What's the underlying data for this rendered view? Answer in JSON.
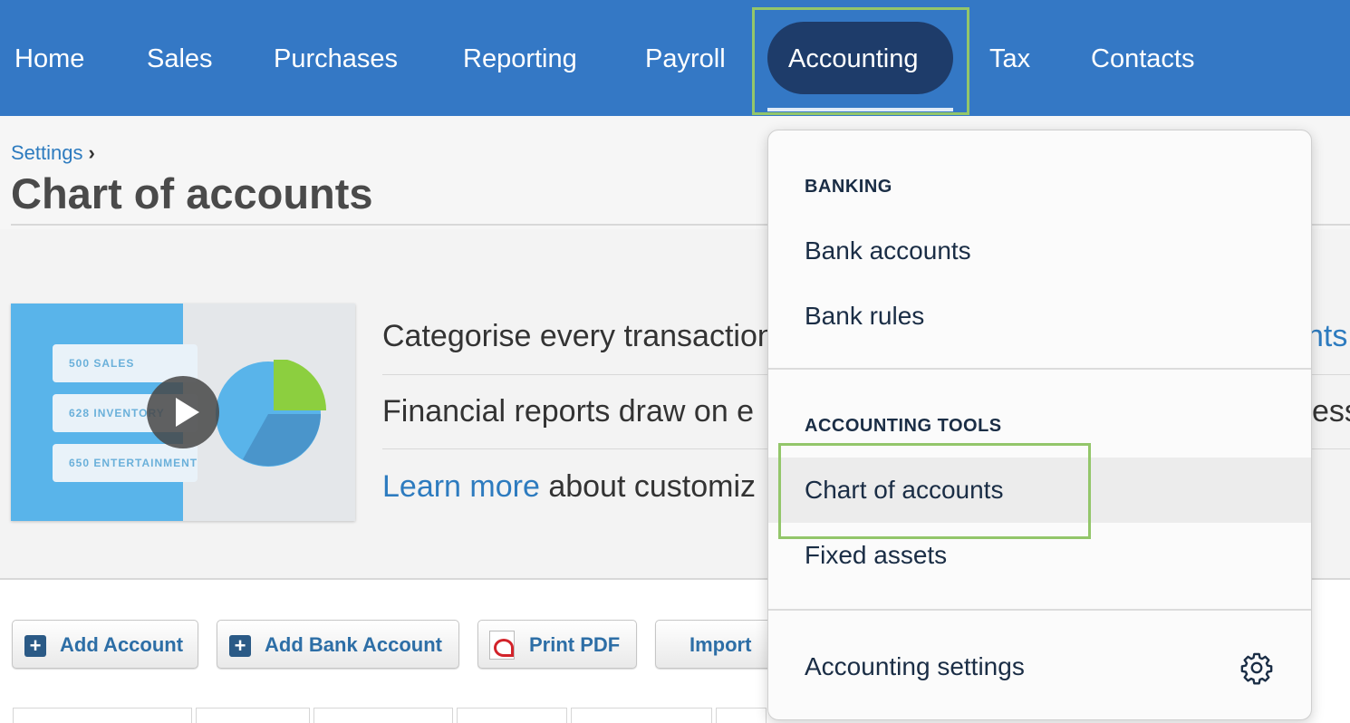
{
  "nav": {
    "items": [
      "Home",
      "Sales",
      "Purchases",
      "Reporting",
      "Payroll",
      "Accounting",
      "Tax",
      "Contacts"
    ],
    "active": "Accounting",
    "highlight_color": "#93c66a",
    "bar_color": "#3478c5"
  },
  "breadcrumb": {
    "label": "Settings",
    "chevron": "›"
  },
  "page": {
    "title": "Chart of accounts"
  },
  "video": {
    "tags": [
      "500  SALES",
      "628  INVENTORY",
      "650  ENTERTAINMENT"
    ],
    "icon": "play-icon"
  },
  "info": {
    "row1": "Categorise every transaction",
    "row1_link_tail": "nts",
    "row2": "Financial reports draw on e",
    "row2_tail": "ess",
    "row3_link": "Learn more",
    "row3_text": " about customiz"
  },
  "toolbar": {
    "add_account": "Add Account",
    "add_bank_account": "Add Bank Account",
    "print_pdf": "Print PDF",
    "import": "Import"
  },
  "menu": {
    "banking_heading": "BANKING",
    "bank_accounts": "Bank accounts",
    "bank_rules": "Bank rules",
    "tools_heading": "ACCOUNTING TOOLS",
    "chart_of_accounts": "Chart of accounts",
    "fixed_assets": "Fixed assets",
    "settings": "Accounting settings",
    "settings_icon": "gear-icon"
  }
}
